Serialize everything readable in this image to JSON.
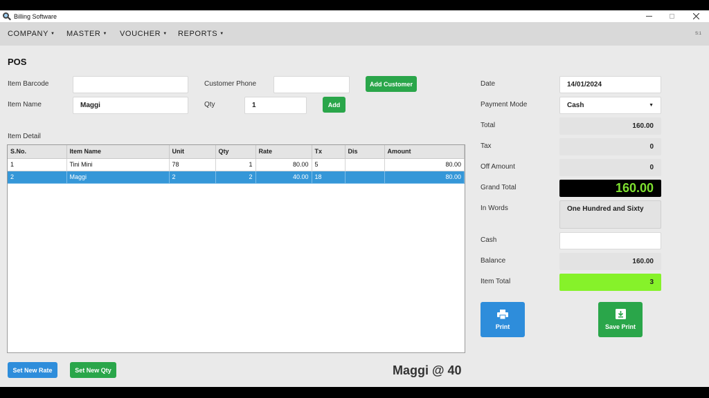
{
  "window": {
    "title": "Billing Software"
  },
  "menu": {
    "items": [
      "COMPANY",
      "MASTER",
      "VOUCHER",
      "REPORTS"
    ],
    "version": "S:1"
  },
  "page": {
    "title": "POS"
  },
  "form": {
    "item_barcode_label": "Item Barcode",
    "item_barcode_value": "",
    "customer_phone_label": "Customer Phone",
    "customer_phone_value": "",
    "add_customer_label": "Add Customer",
    "item_name_label": "Item Name",
    "item_name_value": "Maggi",
    "qty_label": "Qty",
    "qty_value": "1",
    "add_label": "Add",
    "item_detail_label": "Item Detail"
  },
  "table": {
    "columns": [
      "S.No.",
      "Item Name",
      "Unit",
      "Qty",
      "Rate",
      "Tx",
      "Dis",
      "Amount"
    ],
    "rows": [
      [
        "1",
        "Tini Mini",
        "78",
        "1",
        "80.00",
        "5",
        "",
        "80.00"
      ],
      [
        "2",
        "Maggi",
        "2",
        "2",
        "40.00",
        "18",
        "",
        "80.00"
      ]
    ],
    "selected_row": 1
  },
  "summary": {
    "date_label": "Date",
    "date_value": "14/01/2024",
    "payment_mode_label": "Payment Mode",
    "payment_mode_value": "Cash",
    "total_label": "Total",
    "total_value": "160.00",
    "tax_label": "Tax",
    "tax_value": "0",
    "off_amount_label": "Off Amount",
    "off_amount_value": "0",
    "grand_total_label": "Grand Total",
    "grand_total_value": "160.00",
    "in_words_label": "In Words",
    "in_words_value": "One Hundred and Sixty",
    "cash_label": "Cash",
    "cash_value": "",
    "balance_label": "Balance",
    "balance_value": "160.00",
    "item_total_label": "Item Total",
    "item_total_value": "3"
  },
  "actions": {
    "print_label": "Print",
    "save_print_label": "Save Print",
    "set_new_rate_label": "Set New Rate",
    "set_new_qty_label": "Set New Qty"
  },
  "status": {
    "text": "Maggi @ 40"
  },
  "colors": {
    "green_button": "#2aa64a",
    "blue_button": "#2e8ddb",
    "grand_total_bg": "#000000",
    "grand_total_fg": "#7ee030",
    "item_total_bg": "#86f22a",
    "selected_row": "#3597d8"
  },
  "icons": {
    "app": "magnifier-icon",
    "print": "printer-icon",
    "save_print": "save-download-icon"
  }
}
